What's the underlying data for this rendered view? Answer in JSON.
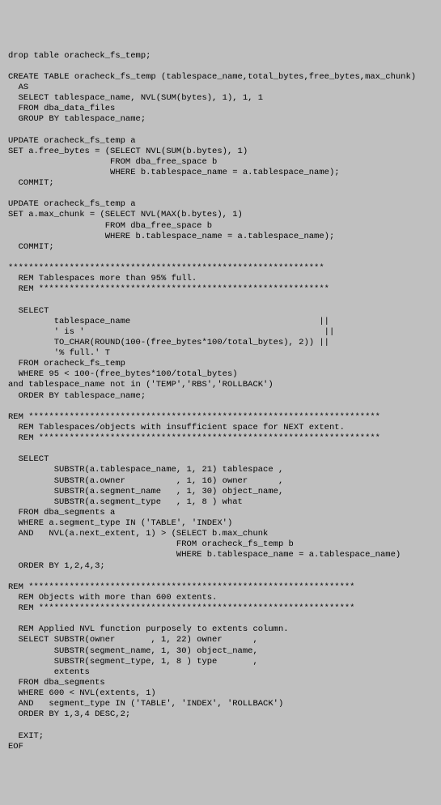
{
  "lines": [
    "drop table oracheck_fs_temp;",
    "",
    "CREATE TABLE oracheck_fs_temp (tablespace_name,total_bytes,free_bytes,max_chunk)",
    "  AS",
    "  SELECT tablespace_name, NVL(SUM(bytes), 1), 1, 1",
    "  FROM dba_data_files",
    "  GROUP BY tablespace_name;",
    "",
    "UPDATE oracheck_fs_temp a",
    "SET a.free_bytes = (SELECT NVL(SUM(b.bytes), 1)",
    "                    FROM dba_free_space b",
    "                    WHERE b.tablespace_name = a.tablespace_name);",
    "  COMMIT;",
    "",
    "UPDATE oracheck_fs_temp a",
    "SET a.max_chunk = (SELECT NVL(MAX(b.bytes), 1)",
    "                   FROM dba_free_space b",
    "                   WHERE b.tablespace_name = a.tablespace_name);",
    "  COMMIT;",
    "",
    "**************************************************************",
    "  REM Tablespaces more than 95% full.",
    "  REM *********************************************************",
    "",
    "  SELECT",
    "         tablespace_name                                     ||",
    "         ' is '                                               ||",
    "         TO_CHAR(ROUND(100-(free_bytes*100/total_bytes), 2)) ||",
    "         '% full.' T",
    "  FROM oracheck_fs_temp",
    "  WHERE 95 < 100-(free_bytes*100/total_bytes)",
    "and tablespace_name not in ('TEMP','RBS','ROLLBACK')",
    "  ORDER BY tablespace_name;",
    "",
    "REM *********************************************************************",
    "  REM Tablespaces/objects with insufficient space for NEXT extent.",
    "  REM *******************************************************************",
    "",
    "  SELECT",
    "         SUBSTR(a.tablespace_name, 1, 21) tablespace ,",
    "         SUBSTR(a.owner          , 1, 16) owner      ,",
    "         SUBSTR(a.segment_name   , 1, 30) object_name,",
    "         SUBSTR(a.segment_type   , 1, 8 ) what",
    "  FROM dba_segments a",
    "  WHERE a.segment_type IN ('TABLE', 'INDEX')",
    "  AND   NVL(a.next_extent, 1) > (SELECT b.max_chunk",
    "                                 FROM oracheck_fs_temp b",
    "                                 WHERE b.tablespace_name = a.tablespace_name)",
    "  ORDER BY 1,2,4,3;",
    "",
    "REM ****************************************************************",
    "  REM Objects with more than 600 extents.",
    "  REM **************************************************************",
    "",
    "  REM Applied NVL function purposely to extents column.",
    "  SELECT SUBSTR(owner       , 1, 22) owner      ,",
    "         SUBSTR(segment_name, 1, 30) object_name,",
    "         SUBSTR(segment_type, 1, 8 ) type       ,",
    "         extents",
    "  FROM dba_segments",
    "  WHERE 600 < NVL(extents, 1)",
    "  AND   segment_type IN ('TABLE', 'INDEX', 'ROLLBACK')",
    "  ORDER BY 1,3,4 DESC,2;",
    "",
    "  EXIT;",
    "EOF"
  ]
}
